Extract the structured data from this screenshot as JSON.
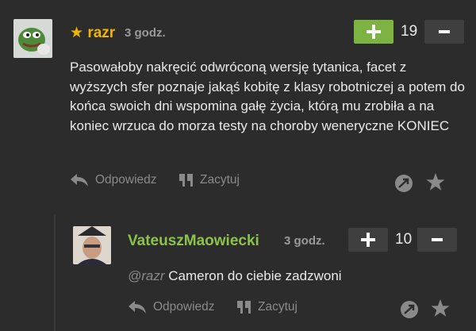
{
  "comment": {
    "username": "razr",
    "star": "★",
    "time": "3 godz.",
    "vote_count": "19",
    "text": "Pasowałoby nakręcić odwróconą wersję tytanica, facet z wyższych sfer poznaje jakąś kobitę z klasy robotniczej a potem do końca swoich dni wspomina gałę życia, którą mu zrobiła a na koniec wrzuca do morza testy na choroby weneryczne KONIEC",
    "reply_label": "Odpowiedz",
    "quote_label": "Zacytuj"
  },
  "reply": {
    "username": "VateuszMaowiecki",
    "time": "3 godz.",
    "vote_count": "10",
    "mention": "@razr",
    "text": " Cameron do ciebie zadzwoni",
    "reply_label": "Odpowiedz",
    "quote_label": "Zacytuj"
  },
  "colors": {
    "background": "#2c2c2c",
    "username_gold": "#f0b400",
    "username_green": "#8bc34a",
    "plus_active": "#7cb342",
    "button_dark": "#3f3f3f",
    "muted": "#8a8a8a"
  },
  "icons": [
    "reply-arrow-icon",
    "quote-icon",
    "share-icon",
    "star-icon",
    "plus-icon",
    "minus-icon"
  ]
}
